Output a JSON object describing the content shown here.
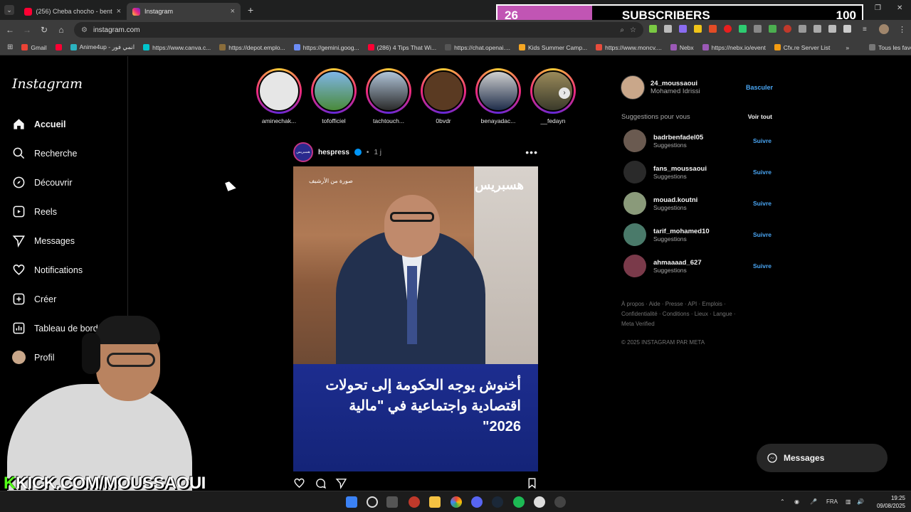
{
  "browser": {
    "tabs": [
      {
        "title": "(256) Cheba chocho - bent 3a2",
        "close": "×"
      },
      {
        "title": "Instagram",
        "close": "×"
      }
    ],
    "new_tab": "+",
    "url": "instagram.com",
    "bookmarks": [
      "Gmail",
      "Anime4up - انمي فور",
      "https://www.canva.c...",
      "https://depot.emplo...",
      "https://gemini.goog...",
      "(286) 4 Tips That Wi...",
      "https://chat.openai....",
      "Kids Summer Camp...",
      "https://www.moncv....",
      "Nebx",
      "https://nebx.io/event",
      "Cfx.re Server List"
    ],
    "more_bookmarks": "»",
    "all_bookmarks": "Tous les favoris"
  },
  "overlay": {
    "count": "26",
    "label": "SUBSCRIBERS",
    "goal": "100",
    "progress": 0.26
  },
  "instagram": {
    "logo": "Instagram",
    "nav": [
      {
        "label": "Accueil",
        "icon": "home-icon"
      },
      {
        "label": "Recherche",
        "icon": "search-icon"
      },
      {
        "label": "Découvrir",
        "icon": "compass-icon"
      },
      {
        "label": "Reels",
        "icon": "reels-icon"
      },
      {
        "label": "Messages",
        "icon": "send-icon"
      },
      {
        "label": "Notifications",
        "icon": "heart-icon"
      },
      {
        "label": "Créer",
        "icon": "plus-square-icon"
      },
      {
        "label": "Tableau de bord",
        "icon": "dashboard-icon"
      },
      {
        "label": "Profil",
        "icon": "avatar"
      }
    ],
    "stories": [
      "aminechak...",
      "tofofficiel",
      "tachtouch...",
      "0bvdr",
      "benayadac...",
      "__fedayn"
    ],
    "post": {
      "username": "hespress",
      "time": "1 j",
      "more": "•••",
      "brand_text": "هسبريس",
      "archive_text": "صورة من الأرشيف",
      "caption": "أخنوش يوجه الحكومة إلى تحولات اقتصادية واجتماعية في \"مالية 2026\""
    },
    "me": {
      "username": "24_moussaoui",
      "name": "Mohamed Idrissi",
      "switch": "Basculer"
    },
    "suggestions_header": "Suggestions pour vous",
    "see_all": "Voir tout",
    "suggestions": [
      {
        "username": "badrbenfadel05",
        "sub": "Suggestions",
        "action": "Suivre"
      },
      {
        "username": "fans_moussaoui",
        "sub": "Suggestions",
        "action": "Suivre"
      },
      {
        "username": "mouad.koutni",
        "sub": "Suggestions",
        "action": "Suivre"
      },
      {
        "username": "tarif_mohamed10",
        "sub": "Suggestions",
        "action": "Suivre"
      },
      {
        "username": "ahmaaaad_627",
        "sub": "Suggestions",
        "action": "Suivre"
      }
    ],
    "footer_line1": "À propos · Aide · Presse · API · Emplois ·",
    "footer_line2": "Confidentialité · Conditions · Lieux · Langue ·",
    "footer_line3": "Meta Verified",
    "copyright": "© 2025 INSTAGRAM PAR META",
    "messages_button": "Messages"
  },
  "stream": {
    "kick_prefix": "K",
    "kick_text": "KICK.COM/MOUSSAOUI"
  },
  "taskbar": {
    "lang": "FRA",
    "time": "19:25",
    "date": "09/08/2025"
  }
}
